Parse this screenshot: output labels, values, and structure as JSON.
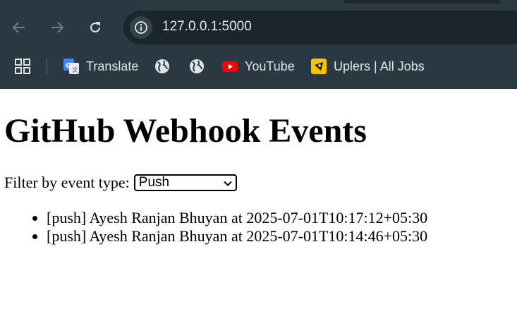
{
  "browser": {
    "url": "127.0.0.1:5000",
    "bookmarks": [
      {
        "label": "Translate",
        "icon": "google-translate-icon"
      },
      {
        "label": "",
        "icon": "globe-icon"
      },
      {
        "label": "",
        "icon": "globe-icon"
      },
      {
        "label": "YouTube",
        "icon": "youtube-icon"
      },
      {
        "label": "Uplers | All Jobs",
        "icon": "uplers-icon"
      }
    ]
  },
  "page": {
    "title": "GitHub Webhook Events",
    "filter_label": "Filter by event type:",
    "filter_selected": "Push",
    "events": [
      "[push] Ayesh Ranjan Bhuyan at 2025-07-01T10:17:12+05:30",
      "[push] Ayesh Ranjan Bhuyan at 2025-07-01T10:14:46+05:30"
    ]
  },
  "colors": {
    "chrome_bg": "#2b3a42",
    "omnibox_bg": "#1b262c",
    "youtube_red": "#ff0000",
    "uplers_yellow": "#f5c400"
  }
}
